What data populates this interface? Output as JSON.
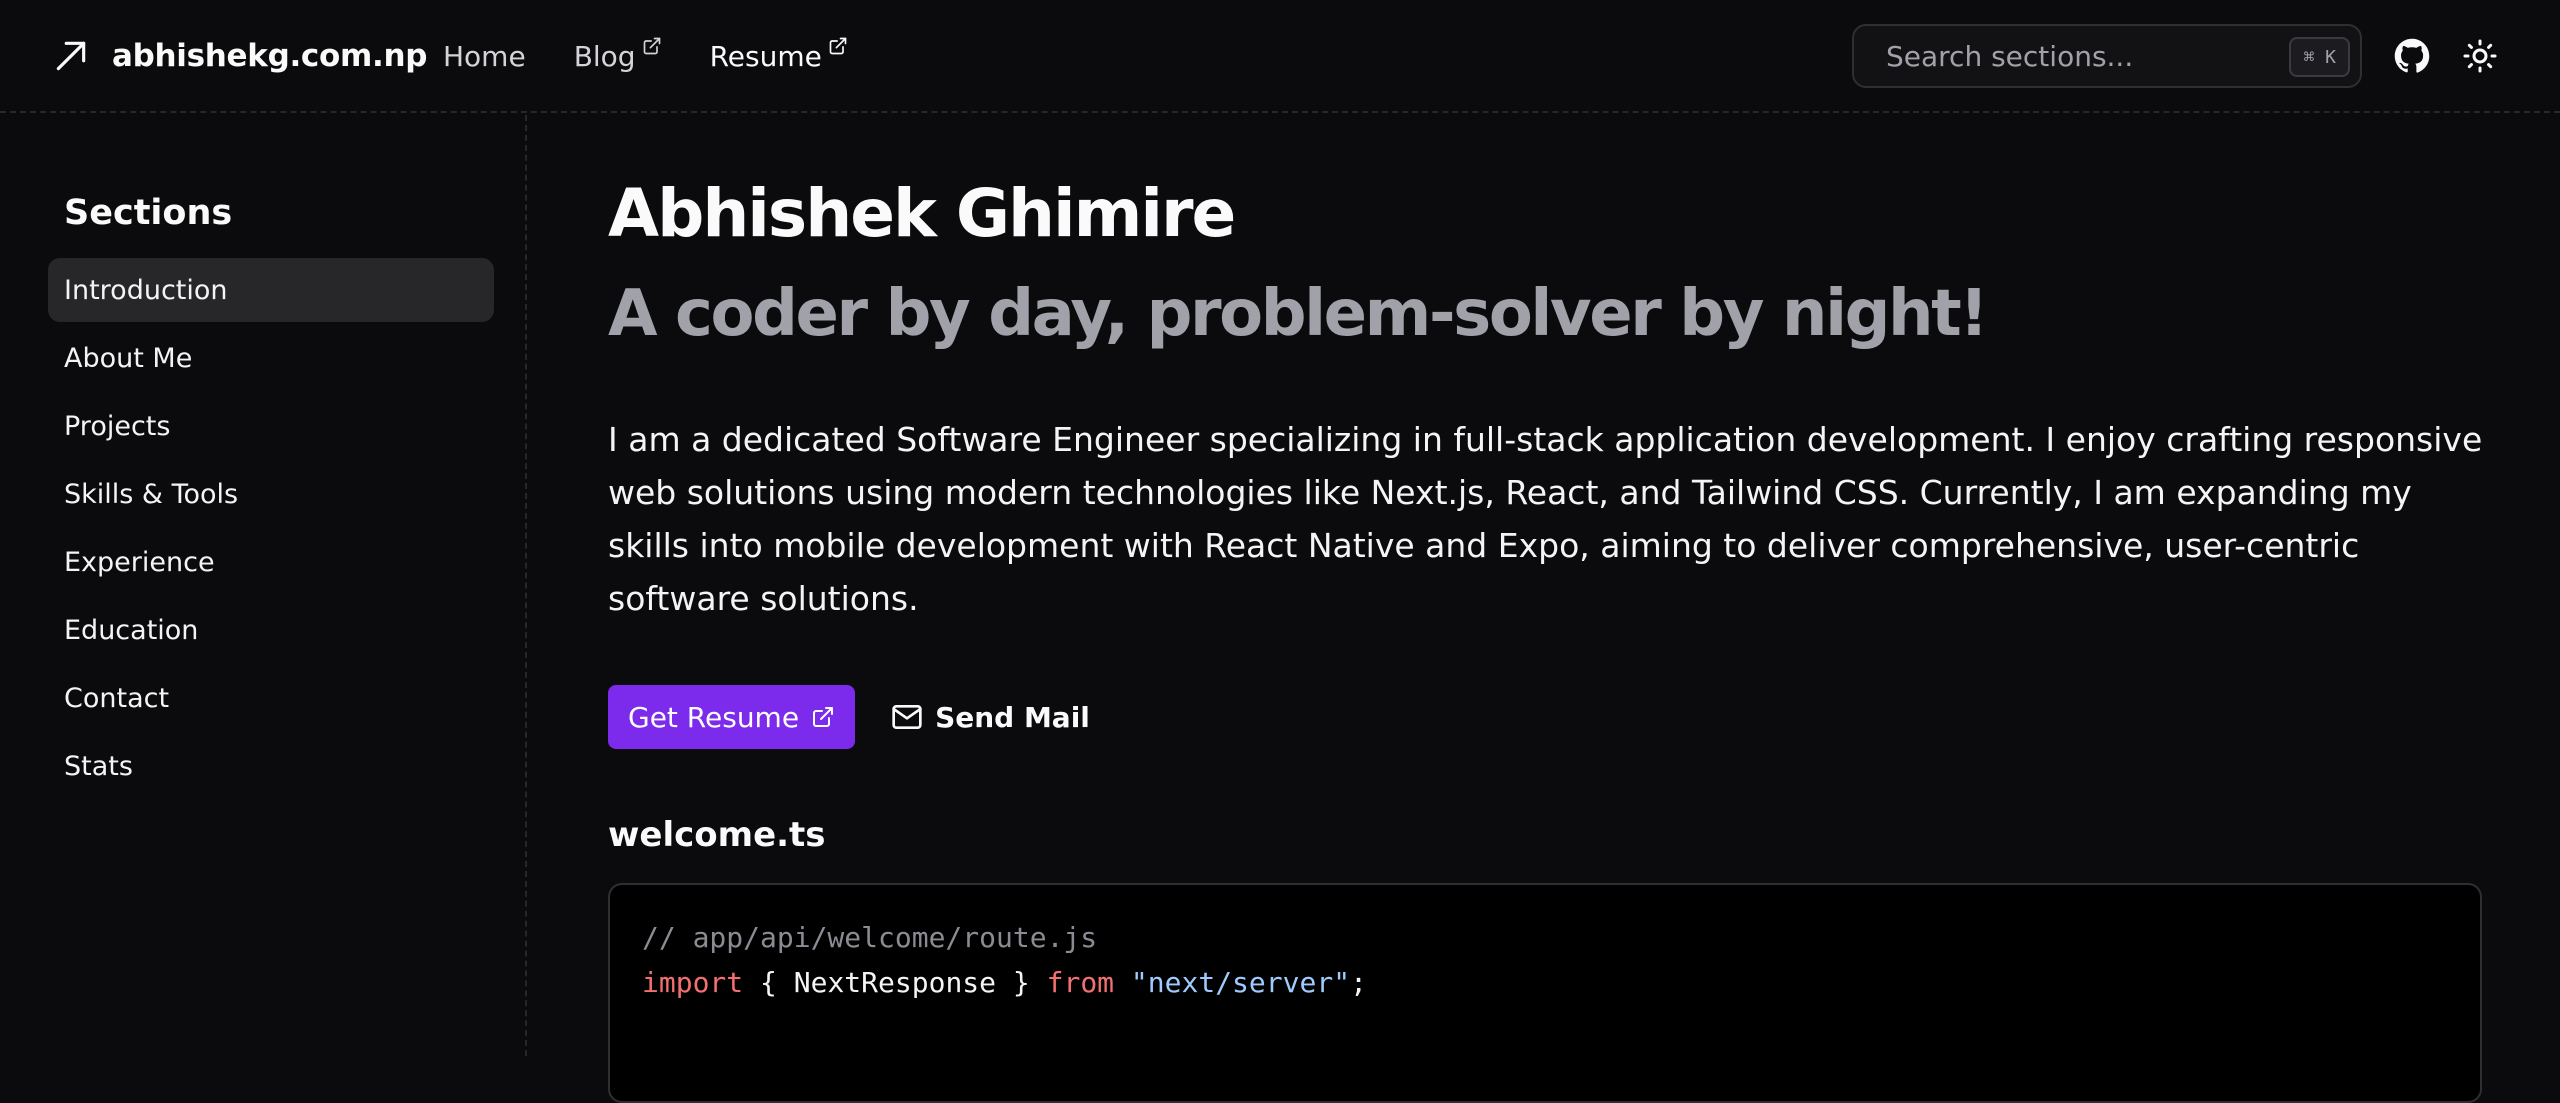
{
  "header": {
    "brand": "abhishekg.com.np",
    "nav": [
      {
        "label": "Home"
      },
      {
        "label": "Blog"
      },
      {
        "label": "Resume"
      }
    ],
    "search": {
      "placeholder": "Search sections...",
      "shortcut": "⌘ K"
    },
    "icons": [
      "arrow-up-right-icon",
      "external-link-icon",
      "github-icon",
      "sun-icon"
    ]
  },
  "sidebar": {
    "title": "Sections",
    "items": [
      {
        "label": "Introduction",
        "active": true
      },
      {
        "label": "About Me"
      },
      {
        "label": "Projects"
      },
      {
        "label": "Skills & Tools"
      },
      {
        "label": "Experience"
      },
      {
        "label": "Education"
      },
      {
        "label": "Contact"
      },
      {
        "label": "Stats"
      }
    ]
  },
  "hero": {
    "name": "Abhishek Ghimire",
    "tagline": "A coder by day, problem-solver by night!",
    "intro": "I am a dedicated Software Engineer specializing in full-stack application development. I enjoy crafting responsive web solutions using modern technologies like Next.js, React, and Tailwind CSS. Currently, I am expanding my skills into mobile development with React Native and Expo, aiming to deliver comprehensive, user-centric software solutions.",
    "primary_button": "Get Resume",
    "secondary_button": "Send Mail"
  },
  "code": {
    "filename": "welcome.ts",
    "comment": "// app/api/welcome/route.js",
    "kw_import": "import",
    "brace_open": " { ",
    "identifier": "NextResponse",
    "brace_close": " } ",
    "kw_from": "from",
    "space": " ",
    "module": "\"next/server\"",
    "semicolon": ";"
  },
  "colors": {
    "background": "#0b0b0d",
    "accent": "#7c2aeb",
    "muted_text": "#a1a1aa",
    "active_item_bg": "#27272a",
    "code_keyword": "#f47070",
    "code_string": "#9ecbff"
  }
}
